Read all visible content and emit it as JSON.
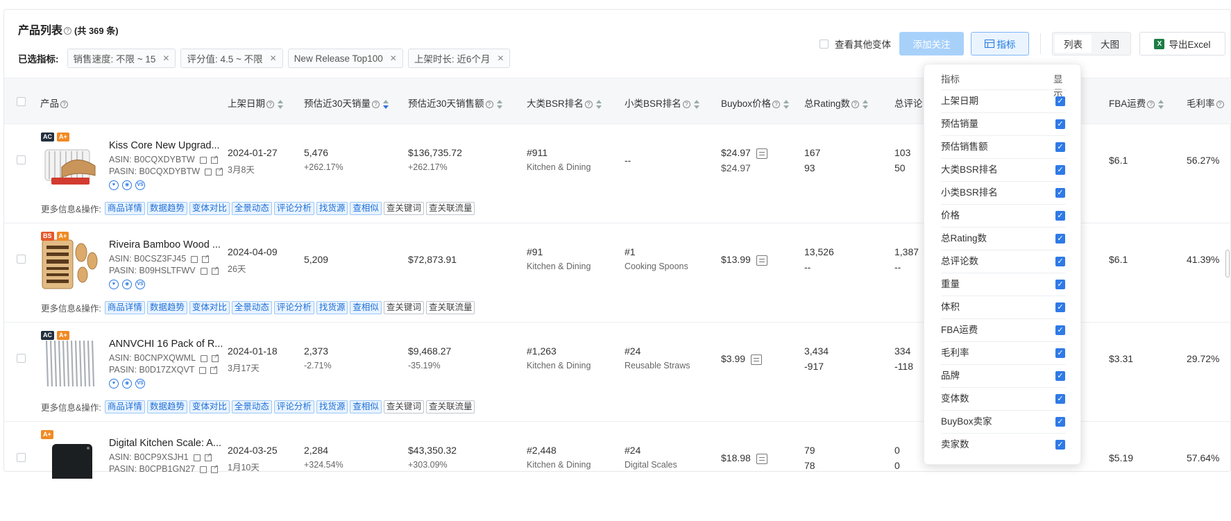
{
  "header": {
    "title": "产品列表",
    "count_text": "(共 369 条)",
    "filters_label": "已选指标:",
    "filters": [
      "销售速度: 不限 ~ 15",
      "评分值: 4.5 ~ 不限",
      "New Release Top100",
      "上架时长: 近6个月"
    ]
  },
  "toolbar": {
    "variant_label": "查看其他变体",
    "follow_label": "添加关注",
    "indicator_label": "指标",
    "view_list": "列表",
    "view_grid": "大图",
    "export_label": "导出Excel"
  },
  "columns": [
    "产品",
    "上架日期",
    "预估近30天销量",
    "预估近30天销售额",
    "大类BSR排名",
    "小类BSR排名",
    "Buybox价格",
    "总Rating数",
    "总评论",
    "FBA运费",
    "毛利率"
  ],
  "actions": {
    "label": "更多信息&操作:",
    "blue": [
      "商品详情",
      "数据趋势",
      "变体对比",
      "全景动态",
      "评论分析",
      "找货源",
      "查相似"
    ],
    "gray": [
      "查关键词",
      "查关联流量"
    ]
  },
  "rows": [
    {
      "badges": [
        "AC",
        "A+"
      ],
      "name": "Kiss Core New Upgrad...",
      "asin": "ASIN: B0CQXDYBTW",
      "pasin": "PASIN: B0CQXDYBTW",
      "date": "2024-01-27",
      "age": "3月8天",
      "sales": "5,476",
      "sales_chg": "+262.17%",
      "revenue": "$136,735.72",
      "revenue_chg": "+262.17%",
      "bsr": "#911",
      "bsr_cat": "Kitchen & Dining",
      "sub_bsr": "--",
      "sub_cat": "",
      "price": "$24.97",
      "price2": "$24.97",
      "rating": "167",
      "rating2": "93",
      "reviews": "103",
      "reviews2": "50",
      "fba": "$6.1",
      "margin": "56.27%"
    },
    {
      "badges": [
        "BS",
        "A+"
      ],
      "name": "Riveira Bamboo Wood ...",
      "asin": "ASIN: B0CSZ3FJ45",
      "pasin": "PASIN: B09HSLTFWV",
      "date": "2024-04-09",
      "age": "26天",
      "sales": "5,209",
      "sales_chg": "",
      "revenue": "$72,873.91",
      "revenue_chg": "",
      "bsr": "#91",
      "bsr_cat": "Kitchen & Dining",
      "sub_bsr": "#1",
      "sub_cat": "Cooking Spoons",
      "price": "$13.99",
      "price2": "",
      "rating": "13,526",
      "rating2": "--",
      "reviews": "1,387",
      "reviews2": "--",
      "fba": "$6.1",
      "margin": "41.39%"
    },
    {
      "badges": [
        "AC",
        "A+"
      ],
      "name": "ANNVCHI 16 Pack of R...",
      "asin": "ASIN: B0CNPXQWML",
      "pasin": "PASIN: B0D17ZXQVT",
      "date": "2024-01-18",
      "age": "3月17天",
      "sales": "2,373",
      "sales_chg": "-2.71%",
      "revenue": "$9,468.27",
      "revenue_chg": "-35.19%",
      "bsr": "#1,263",
      "bsr_cat": "Kitchen & Dining",
      "sub_bsr": "#24",
      "sub_cat": "Reusable Straws",
      "price": "$3.99",
      "price2": "",
      "rating": "3,434",
      "rating2": "-917",
      "reviews": "334",
      "reviews2": "-118",
      "fba": "$3.31",
      "margin": "29.72%"
    },
    {
      "badges": [
        "A+"
      ],
      "name": "Digital Kitchen Scale: A...",
      "asin": "ASIN: B0CP9XSJH1",
      "pasin": "PASIN: B0CPB1GN27",
      "date": "2024-03-25",
      "age": "1月10天",
      "sales": "2,284",
      "sales_chg": "+324.54%",
      "revenue": "$43,350.32",
      "revenue_chg": "+303.09%",
      "bsr": "#2,448",
      "bsr_cat": "Kitchen & Dining",
      "sub_bsr": "#24",
      "sub_cat": "Digital Scales",
      "price": "$18.98",
      "price2": "",
      "rating": "79",
      "rating2": "78",
      "reviews": "0",
      "reviews2": "0",
      "fba": "$5.19",
      "margin": "57.64%"
    }
  ],
  "indicator_menu": {
    "col_name": "指标",
    "col_show": "显示",
    "items": [
      "上架日期",
      "预估销量",
      "预估销售额",
      "大类BSR排名",
      "小类BSR排名",
      "价格",
      "总Rating数",
      "总评论数",
      "重量",
      "体积",
      "FBA运费",
      "毛利率",
      "品牌",
      "变体数",
      "BuyBox卖家",
      "卖家数"
    ]
  },
  "colors": {
    "primary": "#1f7ae0",
    "follow_disabled": "#a8d1fa",
    "check": "#2f7ae6"
  }
}
